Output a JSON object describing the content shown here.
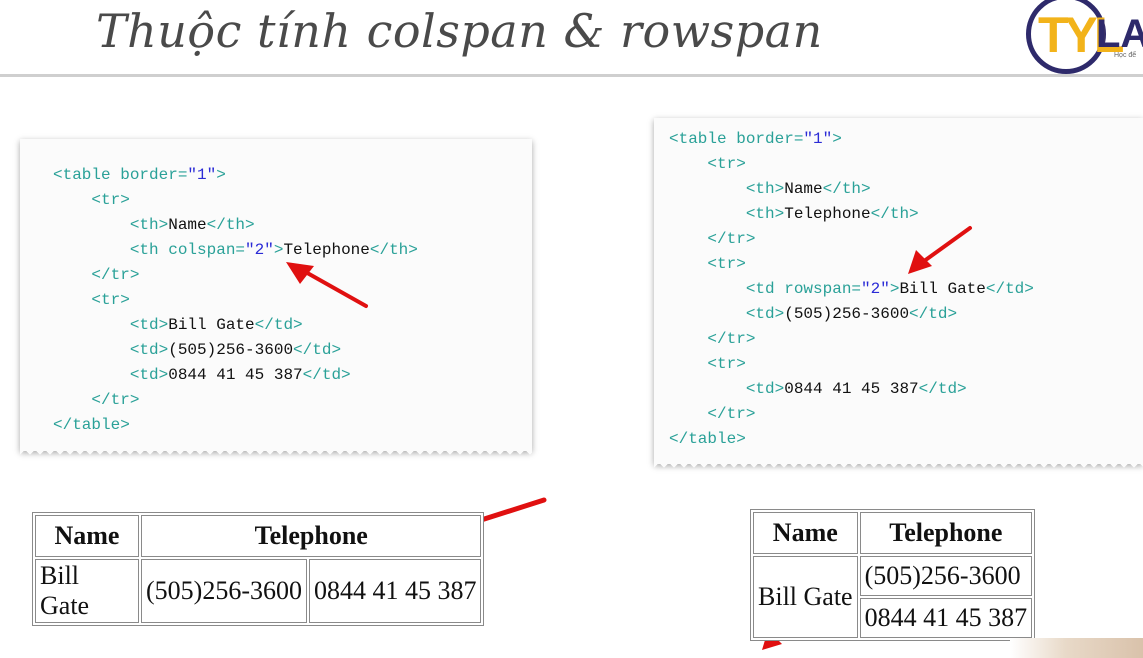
{
  "slide": {
    "title": "Thuộc tính colspan & rowspan",
    "logo": {
      "mark": "TYL",
      "suffix": "LA",
      "tagline": "Học để"
    }
  },
  "left_code": {
    "line1_open": "<table border=",
    "line1_val": "\"1\"",
    "line1_close": ">",
    "tr_open": "<tr>",
    "th_name_open": "<th>",
    "th_name_text": "Name",
    "th_close": "</th>",
    "th_tel_open": "<th colspan=",
    "th_tel_val": "\"2\"",
    "th_tel_gt": ">",
    "th_tel_text": "Telephone",
    "tr_close": "</tr>",
    "td_open": "<td>",
    "td1_text": "Bill Gate",
    "td_close": "</td>",
    "td2_text": "(505)256-3600",
    "td3_text": "0844 41 45 387",
    "table_close": "</table>"
  },
  "right_code": {
    "line1_open": "<table border=",
    "line1_val": "\"1\"",
    "line1_close": ">",
    "tr_open": "<tr>",
    "th_open": "<th>",
    "th_close": "</th>",
    "th1_text": "Name",
    "th2_text": "Telephone",
    "tr_close": "</tr>",
    "td_rs_open": "<td rowspan=",
    "td_rs_val": "\"2\"",
    "td_rs_gt": ">",
    "td1_text": "Bill Gate",
    "td_open": "<td>",
    "td_close": "</td>",
    "td2_text": "(505)256-3600",
    "td3_text": "0844 41 45 387",
    "table_close": "</table>"
  },
  "left_table": {
    "headers": [
      "Name",
      "Telephone"
    ],
    "row": [
      "Bill Gate",
      "(505)256-3600",
      "0844 41 45 387"
    ]
  },
  "right_table": {
    "headers": [
      "Name",
      "Telephone"
    ],
    "rowspan_cell": "Bill Gate",
    "phones": [
      "(505)256-3600",
      "0844 41 45 387"
    ]
  },
  "colors": {
    "tag": "#2aa198",
    "attr_value": "#2b2bd6",
    "arrow": "#e01010",
    "title": "#4a4a4a"
  }
}
